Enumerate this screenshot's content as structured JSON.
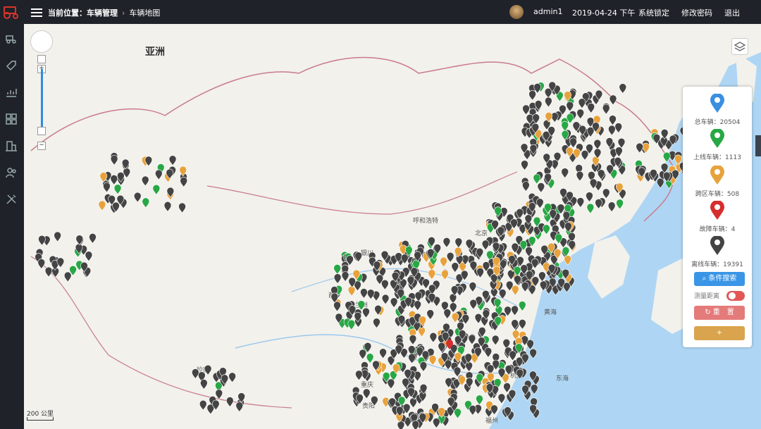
{
  "header": {
    "breadcrumb_prefix": "当前位置：",
    "breadcrumb_section": "车辆管理",
    "breadcrumb_page": "车辆地图",
    "username": "admin1",
    "datetime": "2019-04-24 下午",
    "lock_label": "系统锁定",
    "change_password_label": "修改密码",
    "logout_label": "退出"
  },
  "sidebar": {
    "icons": [
      "vehicle-icon",
      "tag-icon",
      "chart-icon",
      "dashboard-icon",
      "building-icon",
      "users-icon",
      "tools-icon"
    ]
  },
  "map": {
    "continent_label": "亚洲",
    "scale_label": "200 公里",
    "place_labels": [
      "呼和浩特",
      "北京",
      "银川",
      "西宁",
      "兰州",
      "拉萨",
      "重庆",
      "贵阳",
      "杭州",
      "福州",
      "黄海",
      "东海"
    ]
  },
  "stats": {
    "total": {
      "label": "总车辆：20504",
      "color": "#3a8fe0"
    },
    "online": {
      "label": "上线车辆：1113",
      "color": "#28a745"
    },
    "cross": {
      "label": "跨区车辆：508",
      "color": "#e8a23c"
    },
    "fault": {
      "label": "故障车辆：4",
      "color": "#d62e2e"
    },
    "offline": {
      "label": "离线车辆：19391",
      "color": "#444444"
    }
  },
  "controls": {
    "search_button": "条件搜索",
    "measure_label": "测量距离",
    "reset_button": "重　置",
    "add_button": "+"
  }
}
